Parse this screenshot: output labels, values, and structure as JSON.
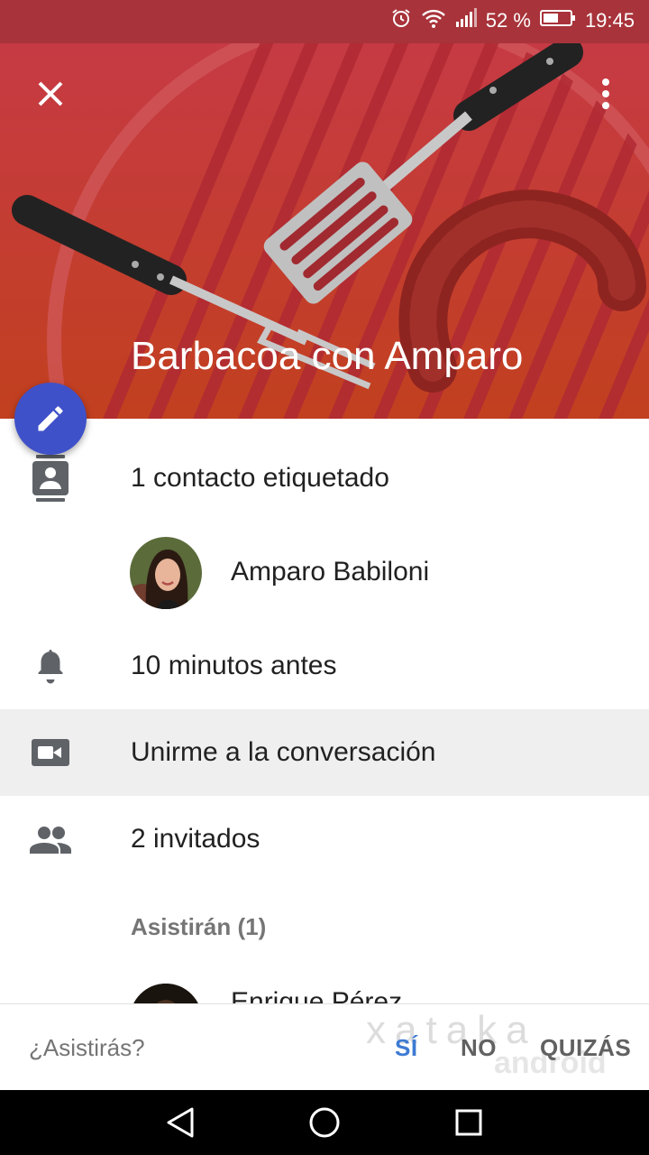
{
  "status_bar": {
    "battery": "52 %",
    "time": "19:45"
  },
  "event": {
    "title": "Barbacoa con Amparo"
  },
  "details": {
    "contacts_label": "1 contacto etiquetado",
    "contact_person": "Amparo Babiloni",
    "reminder": "10 minutos antes",
    "video_call": "Unirme a la conversación",
    "guests_count": "2 invitados",
    "attending_header": "Asistirán (1)",
    "attending_person": "Enrique Pérez"
  },
  "rsvp": {
    "question": "¿Asistirás?",
    "yes": "SÍ",
    "no": "NO",
    "maybe": "QUIZÁS"
  },
  "watermark": {
    "line1": "xataka",
    "line2": "android"
  },
  "colors": {
    "header_red": "#c3383f",
    "status_red": "#a8333a",
    "fab_blue": "#3f51c9",
    "accent_blue": "#3e7bd3",
    "highlight_gray": "#efefef"
  }
}
